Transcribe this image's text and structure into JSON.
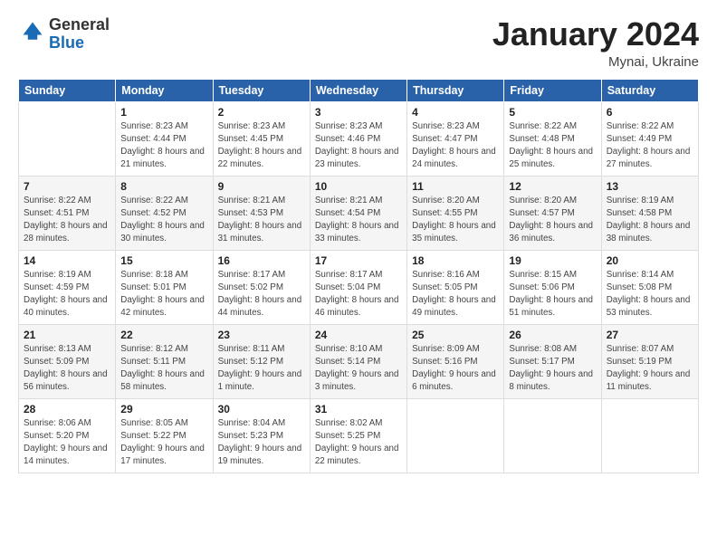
{
  "logo": {
    "general": "General",
    "blue": "Blue"
  },
  "title": "January 2024",
  "subtitle": "Mynai, Ukraine",
  "headers": [
    "Sunday",
    "Monday",
    "Tuesday",
    "Wednesday",
    "Thursday",
    "Friday",
    "Saturday"
  ],
  "weeks": [
    [
      {
        "num": "",
        "sunrise": "",
        "sunset": "",
        "daylight": ""
      },
      {
        "num": "1",
        "sunrise": "Sunrise: 8:23 AM",
        "sunset": "Sunset: 4:44 PM",
        "daylight": "Daylight: 8 hours and 21 minutes."
      },
      {
        "num": "2",
        "sunrise": "Sunrise: 8:23 AM",
        "sunset": "Sunset: 4:45 PM",
        "daylight": "Daylight: 8 hours and 22 minutes."
      },
      {
        "num": "3",
        "sunrise": "Sunrise: 8:23 AM",
        "sunset": "Sunset: 4:46 PM",
        "daylight": "Daylight: 8 hours and 23 minutes."
      },
      {
        "num": "4",
        "sunrise": "Sunrise: 8:23 AM",
        "sunset": "Sunset: 4:47 PM",
        "daylight": "Daylight: 8 hours and 24 minutes."
      },
      {
        "num": "5",
        "sunrise": "Sunrise: 8:22 AM",
        "sunset": "Sunset: 4:48 PM",
        "daylight": "Daylight: 8 hours and 25 minutes."
      },
      {
        "num": "6",
        "sunrise": "Sunrise: 8:22 AM",
        "sunset": "Sunset: 4:49 PM",
        "daylight": "Daylight: 8 hours and 27 minutes."
      }
    ],
    [
      {
        "num": "7",
        "sunrise": "Sunrise: 8:22 AM",
        "sunset": "Sunset: 4:51 PM",
        "daylight": "Daylight: 8 hours and 28 minutes."
      },
      {
        "num": "8",
        "sunrise": "Sunrise: 8:22 AM",
        "sunset": "Sunset: 4:52 PM",
        "daylight": "Daylight: 8 hours and 30 minutes."
      },
      {
        "num": "9",
        "sunrise": "Sunrise: 8:21 AM",
        "sunset": "Sunset: 4:53 PM",
        "daylight": "Daylight: 8 hours and 31 minutes."
      },
      {
        "num": "10",
        "sunrise": "Sunrise: 8:21 AM",
        "sunset": "Sunset: 4:54 PM",
        "daylight": "Daylight: 8 hours and 33 minutes."
      },
      {
        "num": "11",
        "sunrise": "Sunrise: 8:20 AM",
        "sunset": "Sunset: 4:55 PM",
        "daylight": "Daylight: 8 hours and 35 minutes."
      },
      {
        "num": "12",
        "sunrise": "Sunrise: 8:20 AM",
        "sunset": "Sunset: 4:57 PM",
        "daylight": "Daylight: 8 hours and 36 minutes."
      },
      {
        "num": "13",
        "sunrise": "Sunrise: 8:19 AM",
        "sunset": "Sunset: 4:58 PM",
        "daylight": "Daylight: 8 hours and 38 minutes."
      }
    ],
    [
      {
        "num": "14",
        "sunrise": "Sunrise: 8:19 AM",
        "sunset": "Sunset: 4:59 PM",
        "daylight": "Daylight: 8 hours and 40 minutes."
      },
      {
        "num": "15",
        "sunrise": "Sunrise: 8:18 AM",
        "sunset": "Sunset: 5:01 PM",
        "daylight": "Daylight: 8 hours and 42 minutes."
      },
      {
        "num": "16",
        "sunrise": "Sunrise: 8:17 AM",
        "sunset": "Sunset: 5:02 PM",
        "daylight": "Daylight: 8 hours and 44 minutes."
      },
      {
        "num": "17",
        "sunrise": "Sunrise: 8:17 AM",
        "sunset": "Sunset: 5:04 PM",
        "daylight": "Daylight: 8 hours and 46 minutes."
      },
      {
        "num": "18",
        "sunrise": "Sunrise: 8:16 AM",
        "sunset": "Sunset: 5:05 PM",
        "daylight": "Daylight: 8 hours and 49 minutes."
      },
      {
        "num": "19",
        "sunrise": "Sunrise: 8:15 AM",
        "sunset": "Sunset: 5:06 PM",
        "daylight": "Daylight: 8 hours and 51 minutes."
      },
      {
        "num": "20",
        "sunrise": "Sunrise: 8:14 AM",
        "sunset": "Sunset: 5:08 PM",
        "daylight": "Daylight: 8 hours and 53 minutes."
      }
    ],
    [
      {
        "num": "21",
        "sunrise": "Sunrise: 8:13 AM",
        "sunset": "Sunset: 5:09 PM",
        "daylight": "Daylight: 8 hours and 56 minutes."
      },
      {
        "num": "22",
        "sunrise": "Sunrise: 8:12 AM",
        "sunset": "Sunset: 5:11 PM",
        "daylight": "Daylight: 8 hours and 58 minutes."
      },
      {
        "num": "23",
        "sunrise": "Sunrise: 8:11 AM",
        "sunset": "Sunset: 5:12 PM",
        "daylight": "Daylight: 9 hours and 1 minute."
      },
      {
        "num": "24",
        "sunrise": "Sunrise: 8:10 AM",
        "sunset": "Sunset: 5:14 PM",
        "daylight": "Daylight: 9 hours and 3 minutes."
      },
      {
        "num": "25",
        "sunrise": "Sunrise: 8:09 AM",
        "sunset": "Sunset: 5:16 PM",
        "daylight": "Daylight: 9 hours and 6 minutes."
      },
      {
        "num": "26",
        "sunrise": "Sunrise: 8:08 AM",
        "sunset": "Sunset: 5:17 PM",
        "daylight": "Daylight: 9 hours and 8 minutes."
      },
      {
        "num": "27",
        "sunrise": "Sunrise: 8:07 AM",
        "sunset": "Sunset: 5:19 PM",
        "daylight": "Daylight: 9 hours and 11 minutes."
      }
    ],
    [
      {
        "num": "28",
        "sunrise": "Sunrise: 8:06 AM",
        "sunset": "Sunset: 5:20 PM",
        "daylight": "Daylight: 9 hours and 14 minutes."
      },
      {
        "num": "29",
        "sunrise": "Sunrise: 8:05 AM",
        "sunset": "Sunset: 5:22 PM",
        "daylight": "Daylight: 9 hours and 17 minutes."
      },
      {
        "num": "30",
        "sunrise": "Sunrise: 8:04 AM",
        "sunset": "Sunset: 5:23 PM",
        "daylight": "Daylight: 9 hours and 19 minutes."
      },
      {
        "num": "31",
        "sunrise": "Sunrise: 8:02 AM",
        "sunset": "Sunset: 5:25 PM",
        "daylight": "Daylight: 9 hours and 22 minutes."
      },
      {
        "num": "",
        "sunrise": "",
        "sunset": "",
        "daylight": ""
      },
      {
        "num": "",
        "sunrise": "",
        "sunset": "",
        "daylight": ""
      },
      {
        "num": "",
        "sunrise": "",
        "sunset": "",
        "daylight": ""
      }
    ]
  ]
}
